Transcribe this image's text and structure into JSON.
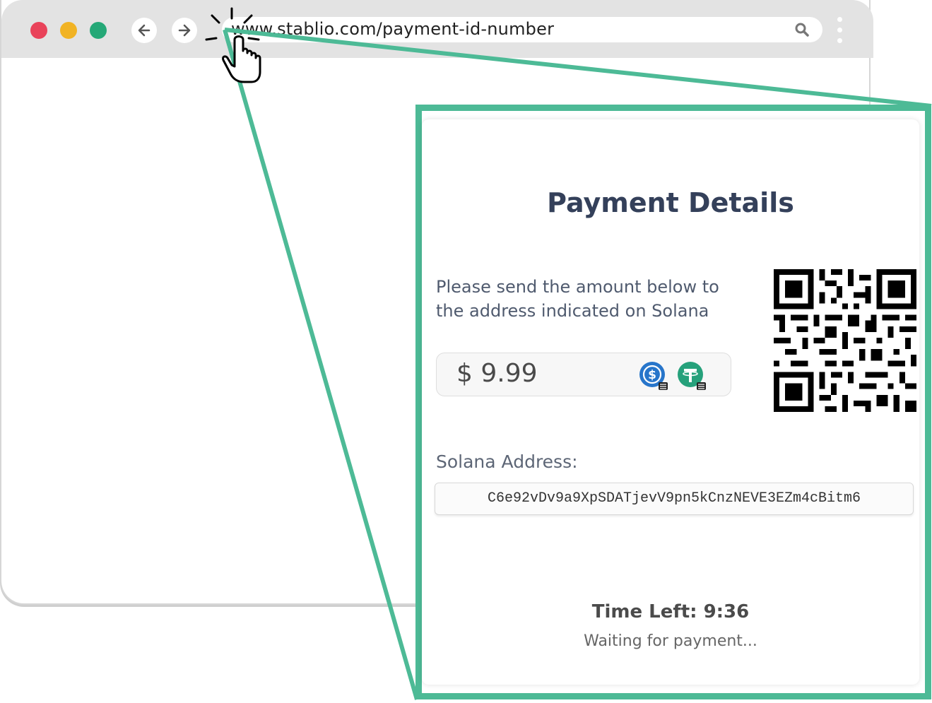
{
  "browser": {
    "url": "www.stablio.com/payment-id-number"
  },
  "payment": {
    "title": "Payment Details",
    "instructions": "Please send the amount below to the address indicated on Solana",
    "amount": "$ 9.99",
    "coins": [
      "usdc-icon",
      "usdt-icon"
    ],
    "address_label": "Solana Address:",
    "address": "C6e92vDv9a9XpSDATjevV9pn5kCnzNEVE3EZm4cBitm6",
    "time_left": "Time Left: 9:36",
    "status": "Waiting for payment..."
  },
  "colors": {
    "accent": "#4dba96",
    "title": "#34405a",
    "usdc": "#2775ca",
    "usdt": "#26a17b"
  }
}
